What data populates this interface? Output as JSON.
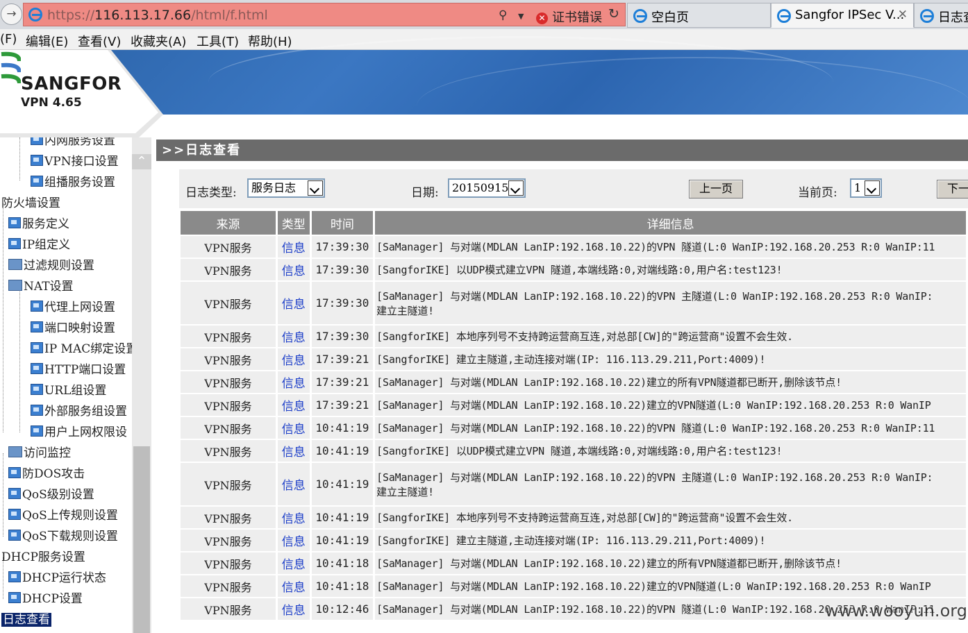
{
  "browser": {
    "url_scheme": "https://",
    "url_host": "116.113.17.66",
    "url_path": "/html/f.html",
    "cert_error": "证书错误",
    "tabs": [
      {
        "label": "空白页"
      },
      {
        "label": "Sangfor IPSec V..."
      },
      {
        "label": "日志查"
      }
    ],
    "menu": [
      "(F)",
      "编辑(E)",
      "查看(V)",
      "收藏夹(A)",
      "工具(T)",
      "帮助(H)"
    ]
  },
  "app": {
    "brand": "SANGFOR",
    "version": "VPN 4.65",
    "colors": {
      "banner": "#3b77c2",
      "title_bar": "#6b6b6b",
      "link": "#1a3cc8"
    }
  },
  "tree": {
    "items": [
      {
        "label": "内网服务设置",
        "icon": "page-icon"
      },
      {
        "label": "VPN接口设置",
        "icon": "page-icon"
      },
      {
        "label": "组播服务设置",
        "icon": "page-icon"
      },
      {
        "label": "防火墙设置",
        "icon": "none"
      },
      {
        "label": "服务定义",
        "icon": "page-icon"
      },
      {
        "label": "IP组定义",
        "icon": "page-icon"
      },
      {
        "label": "过滤规则设置",
        "icon": "folder-icon"
      },
      {
        "label": "NAT设置",
        "icon": "folder-open-icon"
      },
      {
        "label": "代理上网设置",
        "icon": "page-icon"
      },
      {
        "label": "端口映射设置",
        "icon": "page-icon"
      },
      {
        "label": "IP MAC绑定设置",
        "icon": "page-icon"
      },
      {
        "label": "HTTP端口设置",
        "icon": "page-icon"
      },
      {
        "label": "URL组设置",
        "icon": "page-icon"
      },
      {
        "label": "外部服务组设置",
        "icon": "page-icon"
      },
      {
        "label": "用户上网权限设",
        "icon": "page-icon"
      },
      {
        "label": "访问监控",
        "icon": "folder-icon"
      },
      {
        "label": "防DOS攻击",
        "icon": "page-icon"
      },
      {
        "label": "QoS级别设置",
        "icon": "page-icon"
      },
      {
        "label": "QoS上传规则设置",
        "icon": "page-icon"
      },
      {
        "label": "QoS下载规则设置",
        "icon": "page-icon"
      },
      {
        "label": "DHCP服务设置",
        "icon": "none"
      },
      {
        "label": "DHCP运行状态",
        "icon": "page-icon"
      },
      {
        "label": "DHCP设置",
        "icon": "page-icon"
      },
      {
        "label": "日志查看",
        "icon": "none"
      }
    ]
  },
  "page": {
    "title": ">>日志查看",
    "filters": {
      "log_type_label": "日志类型:",
      "log_type_value": "服务日志",
      "date_label": "日期:",
      "date_value": "20150915",
      "prev_label": "上一页",
      "current_page_label": "当前页:",
      "current_page_value": "1",
      "next_label": "下一"
    },
    "table": {
      "headers": [
        "来源",
        "类型",
        "时间",
        "详细信息"
      ],
      "rows": [
        {
          "source": "VPN服务",
          "type": "信息",
          "time": "17:39:30",
          "detail": [
            "[SaManager] 与对端(MDLAN LanIP:192.168.10.22)的VPN 隧道(L:0 WanIP:192.168.20.253 R:0 WanIP:11"
          ]
        },
        {
          "source": "VPN服务",
          "type": "信息",
          "time": "17:39:30",
          "detail": [
            "[SangforIKE] 以UDP模式建立VPN 隧道,本端线路:0,对端线路:0,用户名:test123!"
          ]
        },
        {
          "source": "VPN服务",
          "type": "信息",
          "time": "17:39:30",
          "detail": [
            "[SaManager] 与对端(MDLAN LanIP:192.168.10.22)的VPN 主隧道(L:0 WanIP:192.168.20.253 R:0 WanIP:",
            "建立主隧道!"
          ]
        },
        {
          "source": "VPN服务",
          "type": "信息",
          "time": "17:39:30",
          "detail": [
            "[SangforIKE] 本地序列号不支持跨运营商互连,对总部[CW]的\"跨运营商\"设置不会生效."
          ]
        },
        {
          "source": "VPN服务",
          "type": "信息",
          "time": "17:39:21",
          "detail": [
            "[SangforIKE] 建立主隧道,主动连接对端(IP: 116.113.29.211,Port:4009)!"
          ]
        },
        {
          "source": "VPN服务",
          "type": "信息",
          "time": "17:39:21",
          "detail": [
            "[SaManager] 与对端(MDLAN LanIP:192.168.10.22)建立的所有VPN隧道都已断开,删除该节点!"
          ]
        },
        {
          "source": "VPN服务",
          "type": "信息",
          "time": "17:39:21",
          "detail": [
            "[SaManager] 与对端(MDLAN LanIP:192.168.10.22)建立的VPN隧道(L:0 WanIP:192.168.20.253 R:0 WanIP"
          ]
        },
        {
          "source": "VPN服务",
          "type": "信息",
          "time": "10:41:19",
          "detail": [
            "[SaManager] 与对端(MDLAN LanIP:192.168.10.22)的VPN 隧道(L:0 WanIP:192.168.20.253 R:0 WanIP:11"
          ]
        },
        {
          "source": "VPN服务",
          "type": "信息",
          "time": "10:41:19",
          "detail": [
            "[SangforIKE] 以UDP模式建立VPN 隧道,本端线路:0,对端线路:0,用户名:test123!"
          ]
        },
        {
          "source": "VPN服务",
          "type": "信息",
          "time": "10:41:19",
          "detail": [
            "[SaManager] 与对端(MDLAN LanIP:192.168.10.22)的VPN 主隧道(L:0 WanIP:192.168.20.253 R:0 WanIP:",
            "建立主隧道!"
          ]
        },
        {
          "source": "VPN服务",
          "type": "信息",
          "time": "10:41:19",
          "detail": [
            "[SangforIKE] 本地序列号不支持跨运营商互连,对总部[CW]的\"跨运营商\"设置不会生效."
          ]
        },
        {
          "source": "VPN服务",
          "type": "信息",
          "time": "10:41:19",
          "detail": [
            "[SangforIKE] 建立主隧道,主动连接对端(IP: 116.113.29.211,Port:4009)!"
          ]
        },
        {
          "source": "VPN服务",
          "type": "信息",
          "time": "10:41:18",
          "detail": [
            "[SaManager] 与对端(MDLAN LanIP:192.168.10.22)建立的所有VPN隧道都已断开,删除该节点!"
          ]
        },
        {
          "source": "VPN服务",
          "type": "信息",
          "time": "10:41:18",
          "detail": [
            "[SaManager] 与对端(MDLAN LanIP:192.168.10.22)建立的VPN隧道(L:0 WanIP:192.168.20.253 R:0 WanIP"
          ]
        },
        {
          "source": "VPN服务",
          "type": "信息",
          "time": "10:12:46",
          "detail": [
            "[SaManager] 与对端(MDLAN LanIP:192.168.10.22)的VPN 隧道(L:0 WanIP:192.168.20.253 R:0 WanIP:11"
          ]
        }
      ]
    }
  },
  "watermark": "www.wooyun.org"
}
